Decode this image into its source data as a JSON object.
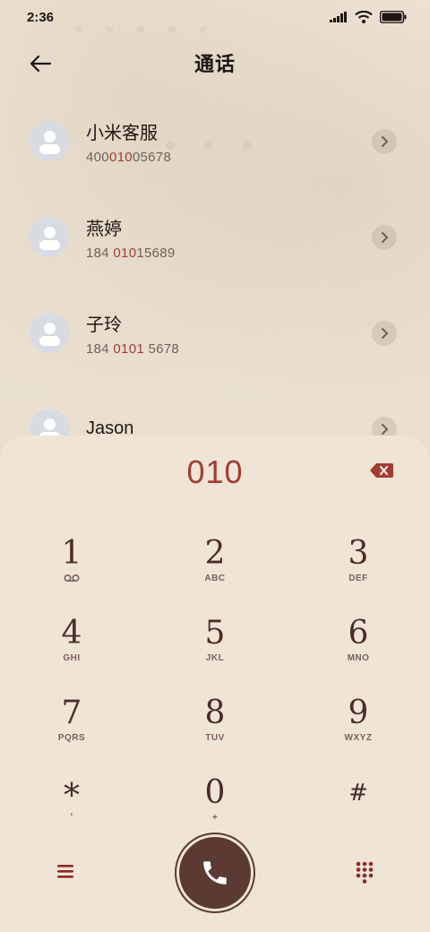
{
  "status_bar": {
    "time": "2:36"
  },
  "header": {
    "title": "通话"
  },
  "contacts": [
    {
      "name": "小米客服",
      "number_parts": [
        "400",
        "010",
        "05678"
      ]
    },
    {
      "name": "燕婷",
      "number_parts": [
        "184 ",
        "010",
        "15689"
      ]
    },
    {
      "name": "子玲",
      "number_parts": [
        "184 ",
        "0101",
        " 5678"
      ]
    },
    {
      "name": "Jason",
      "number_parts": [
        "",
        "",
        ""
      ]
    }
  ],
  "dialer": {
    "input": "010",
    "keys": [
      {
        "digit": "1",
        "letters": ""
      },
      {
        "digit": "2",
        "letters": "ABC"
      },
      {
        "digit": "3",
        "letters": "DEF"
      },
      {
        "digit": "4",
        "letters": "GHI"
      },
      {
        "digit": "5",
        "letters": "JKL"
      },
      {
        "digit": "6",
        "letters": "MNO"
      },
      {
        "digit": "7",
        "letters": "PQRS"
      },
      {
        "digit": "8",
        "letters": "TUV"
      },
      {
        "digit": "9",
        "letters": "WXYZ"
      },
      {
        "digit": "*",
        "letters": ","
      },
      {
        "digit": "0",
        "letters": "+"
      },
      {
        "digit": "#",
        "letters": ""
      }
    ]
  },
  "icons": {
    "back": "arrow-left-icon",
    "backspace": "backspace-icon",
    "voicemail": "voicemail-icon",
    "menu": "menu-icon",
    "call": "phone-icon",
    "dialpad": "dialpad-icon"
  },
  "colors": {
    "accent": "#a23d33",
    "key_text": "#4a2d27",
    "call_button": "#5a3a33",
    "panel": "#f0e4d6"
  }
}
